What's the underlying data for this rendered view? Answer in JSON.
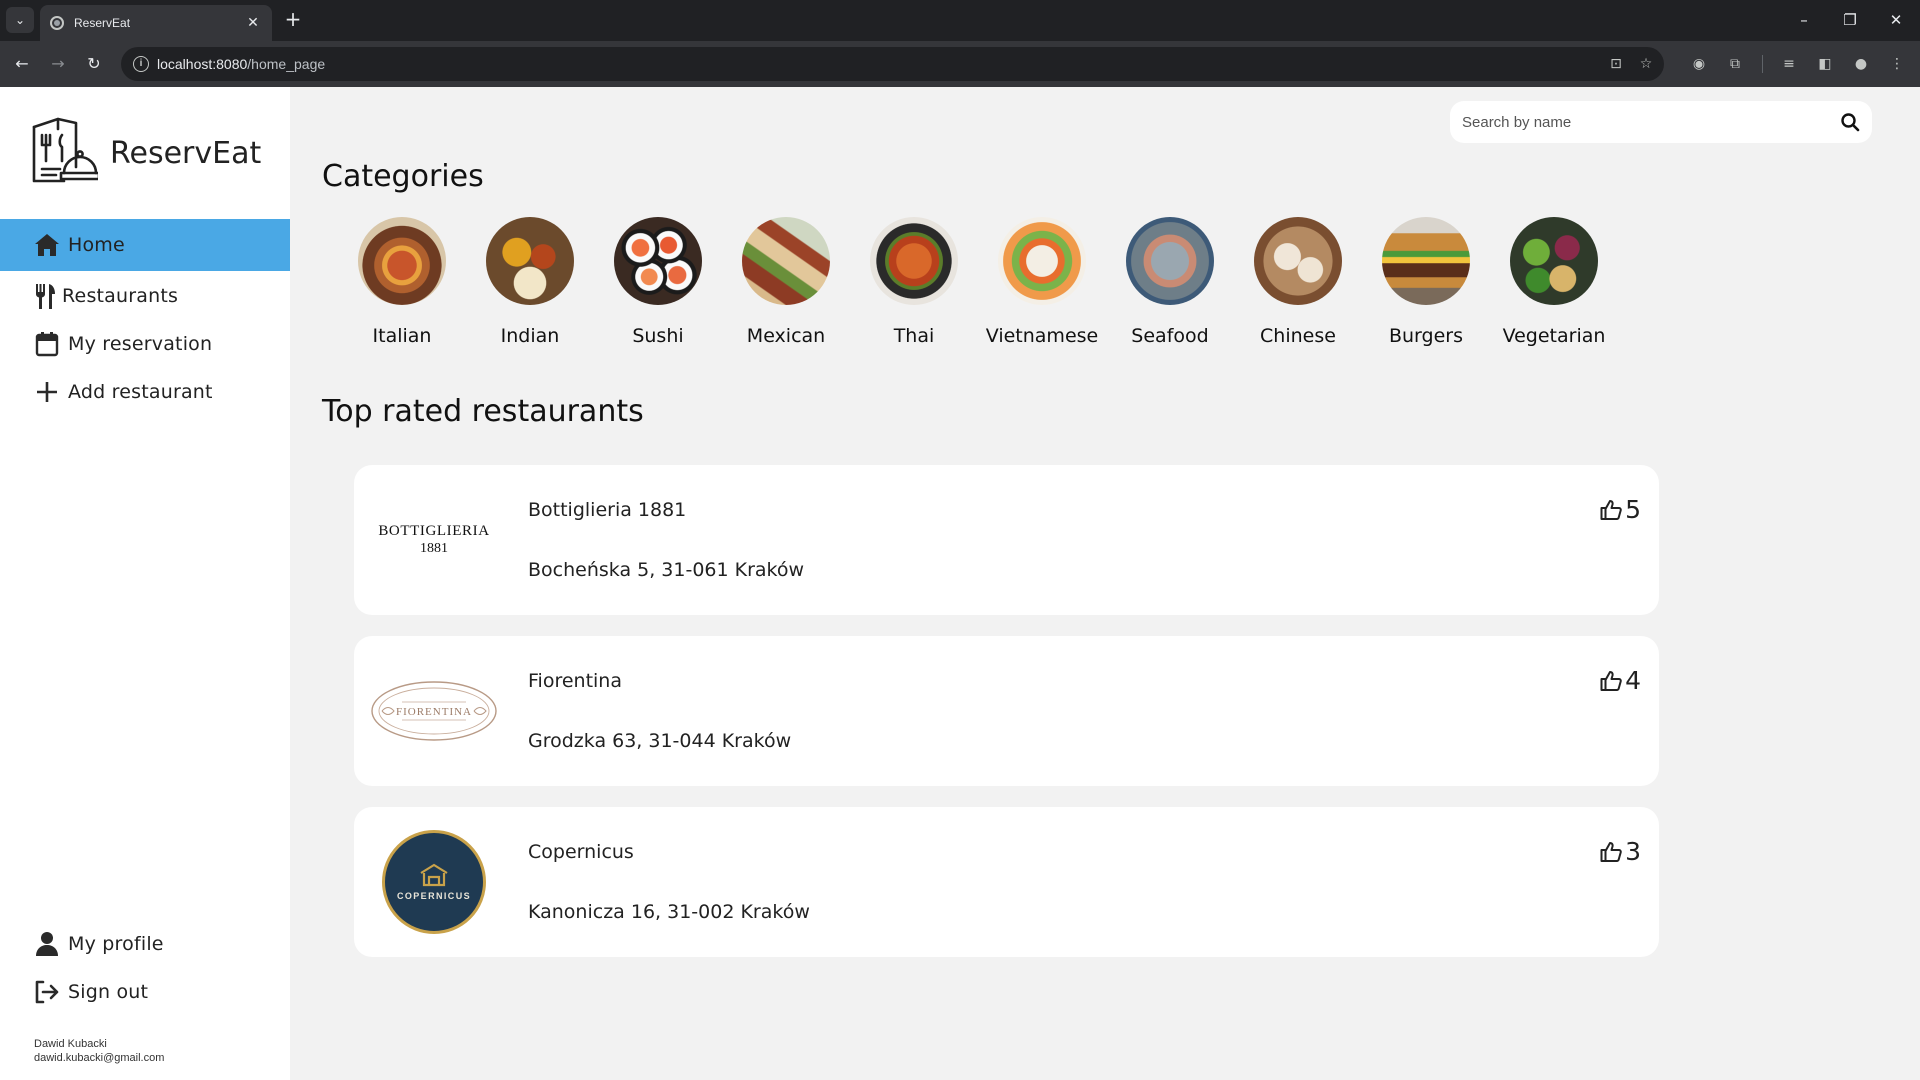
{
  "browser": {
    "tab_title": "ReservEat",
    "url_host": "localhost:8080",
    "url_path": "/home_page"
  },
  "app": {
    "name": "ReservEat"
  },
  "sidebar": {
    "items": [
      {
        "label": "Home",
        "icon": "home-icon",
        "active": true
      },
      {
        "label": "Restaurants",
        "icon": "utensils-icon"
      },
      {
        "label": "My reservation",
        "icon": "calendar-icon"
      },
      {
        "label": "Add restaurant",
        "icon": "plus-icon"
      }
    ],
    "bottom_items": [
      {
        "label": "My profile",
        "icon": "user-icon"
      },
      {
        "label": "Sign out",
        "icon": "sign-out-icon"
      }
    ],
    "user_name": "Dawid Kubacki",
    "user_email": "dawid.kubacki@gmail.com"
  },
  "search": {
    "placeholder": "Search by name"
  },
  "categories": {
    "title": "Categories",
    "items": [
      {
        "label": "Italian"
      },
      {
        "label": "Indian"
      },
      {
        "label": "Sushi"
      },
      {
        "label": "Mexican"
      },
      {
        "label": "Thai"
      },
      {
        "label": "Vietnamese"
      },
      {
        "label": "Seafood"
      },
      {
        "label": "Chinese"
      },
      {
        "label": "Burgers"
      },
      {
        "label": "Vegetarian"
      }
    ]
  },
  "top_rated": {
    "title": "Top rated restaurants",
    "restaurants": [
      {
        "name": "Bottiglieria 1881",
        "address": "Bocheńska 5, 31-061 Kraków",
        "rating": "5",
        "logo_text": "BOTTIGLIERIA",
        "logo_subtext": "1881"
      },
      {
        "name": "Fiorentina",
        "address": "Grodzka 63, 31-044 Kraków",
        "rating": "4",
        "logo_text": "FIORENTINA"
      },
      {
        "name": "Copernicus",
        "address": "Kanonicza 16, 31-002 Kraków",
        "rating": "3",
        "logo_text": "COPERNICUS"
      }
    ]
  },
  "colors": {
    "sidebar_active": "#4aa8e5",
    "page_background": "#f2f2f2",
    "copernicus_navy": "#1f3a52",
    "copernicus_gold": "#c9a24a"
  }
}
